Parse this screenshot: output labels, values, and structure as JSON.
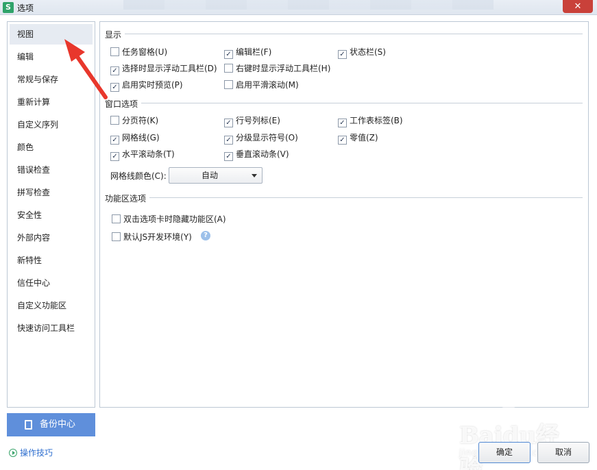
{
  "window": {
    "title": "选项",
    "app_icon_letter": "S",
    "close_glyph": "✕"
  },
  "sidebar": {
    "items": [
      {
        "label": "视图",
        "active": true
      },
      {
        "label": "编辑"
      },
      {
        "label": "常规与保存"
      },
      {
        "label": "重新计算"
      },
      {
        "label": "自定义序列"
      },
      {
        "label": "颜色"
      },
      {
        "label": "错误检查"
      },
      {
        "label": "拼写检查"
      },
      {
        "label": "安全性"
      },
      {
        "label": "外部内容"
      },
      {
        "label": "新特性"
      },
      {
        "label": "信任中心"
      },
      {
        "label": "自定义功能区"
      },
      {
        "label": "快速访问工具栏"
      }
    ]
  },
  "backup": {
    "label": "备份中心"
  },
  "tips": {
    "label": "操作技巧"
  },
  "display": {
    "title": "显示",
    "options": [
      {
        "label": "任务窗格(U)",
        "checked": false
      },
      {
        "label": "编辑栏(F)",
        "checked": true
      },
      {
        "label": "状态栏(S)",
        "checked": true
      },
      {
        "label": "选择时显示浮动工具栏(D)",
        "checked": true
      },
      {
        "label": "右键时显示浮动工具栏(H)",
        "checked": false
      },
      {
        "label": "启用实时预览(P)",
        "checked": true
      },
      {
        "label": "启用平滑滚动(M)",
        "checked": false
      }
    ]
  },
  "window_options": {
    "title": "窗口选项",
    "options": [
      {
        "label": "分页符(K)",
        "checked": false
      },
      {
        "label": "行号列标(E)",
        "checked": true
      },
      {
        "label": "工作表标签(B)",
        "checked": true
      },
      {
        "label": "网格线(G)",
        "checked": true
      },
      {
        "label": "分级显示符号(O)",
        "checked": true
      },
      {
        "label": "零值(Z)",
        "checked": true
      },
      {
        "label": "水平滚动条(T)",
        "checked": true
      },
      {
        "label": "垂直滚动条(V)",
        "checked": true
      }
    ],
    "grid_color_label": "网格线颜色(C):",
    "grid_color_value": "自动"
  },
  "ribbon": {
    "title": "功能区选项",
    "options": [
      {
        "label": "双击选项卡时隐藏功能区(A)",
        "checked": false
      },
      {
        "label": "默认JS开发环境(Y)",
        "checked": false
      }
    ],
    "help_glyph": "?"
  },
  "buttons": {
    "ok": "确定",
    "cancel": "取消"
  },
  "watermark": {
    "brand": "Baidu经验",
    "sub": "jingyan.baidu.com"
  },
  "colors": {
    "accent": "#5f8fdb",
    "close": "#c9413a",
    "annotation_arrow": "#e8372c"
  }
}
